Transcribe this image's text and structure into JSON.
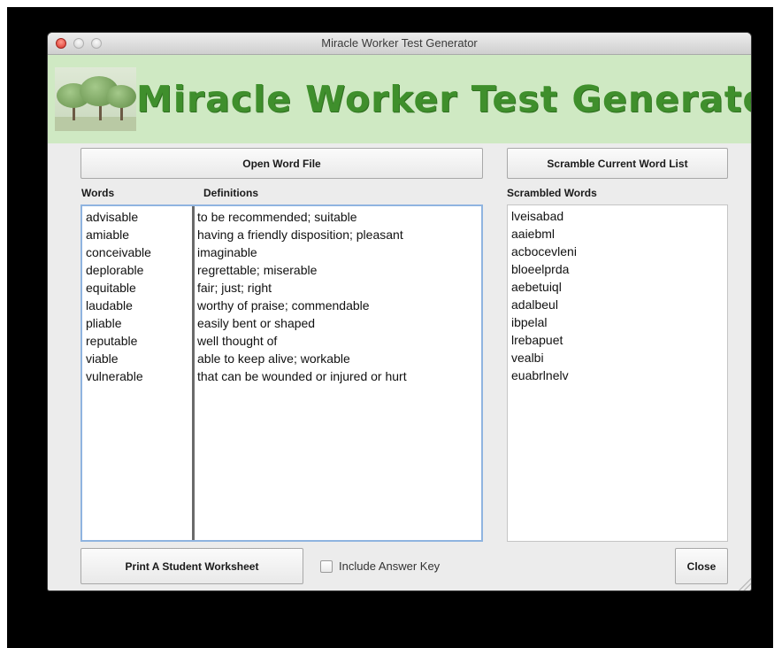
{
  "window": {
    "title": "Miracle Worker Test Generator"
  },
  "banner": {
    "title": "Miracle Worker Test Generator",
    "image": "trees-icon"
  },
  "toolbar": {
    "open_label": "Open Word File",
    "scramble_label": "Scramble Current Word List"
  },
  "columns": {
    "words": "Words",
    "definitions": "Definitions",
    "scrambled": "Scrambled Words"
  },
  "words": [
    "advisable",
    "amiable",
    "conceivable",
    "deplorable",
    "equitable",
    "laudable",
    "pliable",
    "reputable",
    "viable",
    "vulnerable"
  ],
  "definitions": [
    "to be recommended; suitable",
    "having a friendly disposition; pleasant",
    "imaginable",
    "regrettable; miserable",
    "fair; just; right",
    "worthy of praise; commendable",
    "easily bent or shaped",
    "well thought of",
    "able to keep alive; workable",
    "that can be wounded or injured or hurt"
  ],
  "scrambled": [
    "lveisabad",
    "aaiebml",
    "acbocevleni",
    "bloeelprda",
    "aebetuiql",
    "adalbeul",
    "ibpelal",
    "lrebapuet",
    "vealbi",
    "euabrlnelv"
  ],
  "footer": {
    "print_label": "Print A Student Worksheet",
    "answer_key_label": "Include Answer Key",
    "answer_key_checked": false,
    "close_label": "Close"
  },
  "colors": {
    "banner_bg": "#cfe9c3",
    "banner_text": "#3f8f2c",
    "focus_border": "#8fb4e0"
  }
}
